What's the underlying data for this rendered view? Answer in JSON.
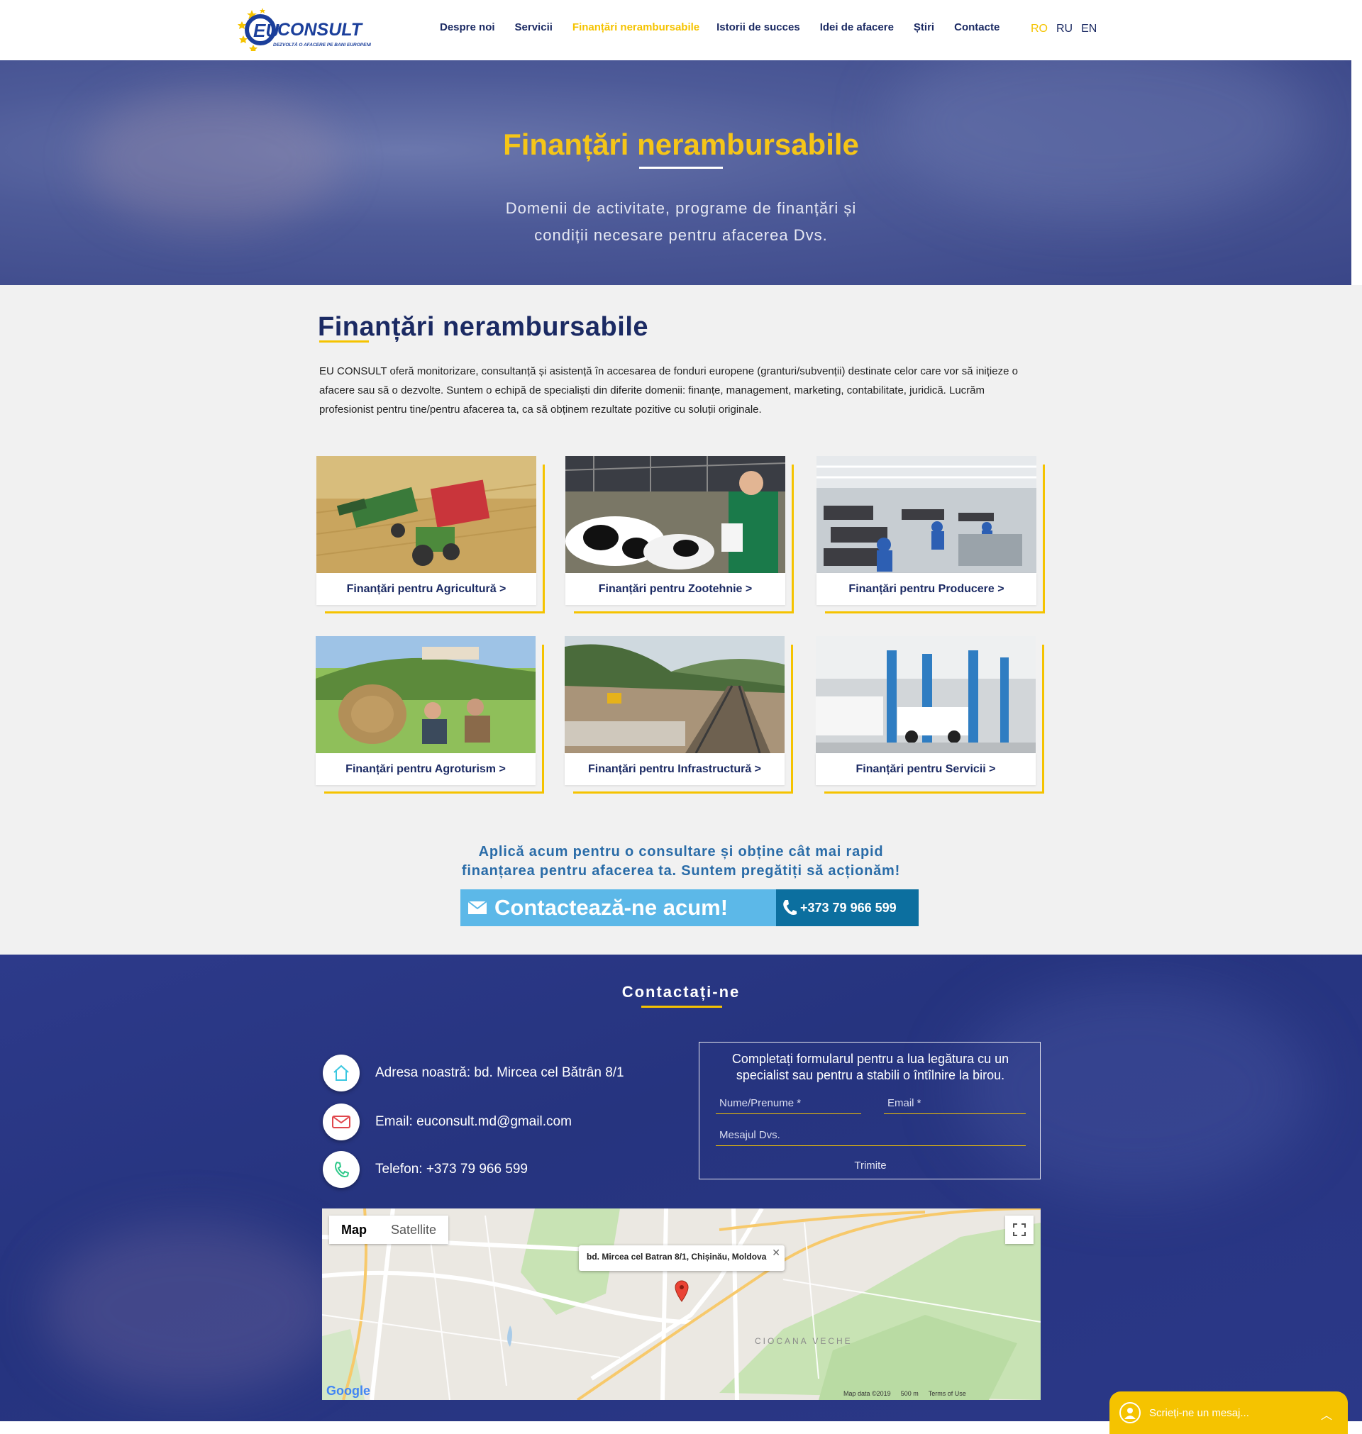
{
  "header": {
    "logo": {
      "brand": "EU CONSULT",
      "tagline": "DEZVOLTĂ O AFACERE PE BANI EUROPENI"
    },
    "nav": [
      {
        "label": "Despre noi",
        "active": false
      },
      {
        "label": "Servicii",
        "active": false
      },
      {
        "label": "Finanțări nerambursabile",
        "active": true
      },
      {
        "label": "Istorii de succes",
        "active": false
      },
      {
        "label": "Idei de afacere",
        "active": false
      },
      {
        "label": "Știri",
        "active": false
      },
      {
        "label": "Contacte",
        "active": false
      }
    ],
    "languages": [
      "RO",
      "RU",
      "EN"
    ]
  },
  "hero": {
    "title": "Finanțări nerambursabile",
    "subtitle_line1": "Domenii de activitate, programe de finanțări și",
    "subtitle_line2": "condiții necesare pentru afacerea Dvs."
  },
  "main": {
    "title": "Finanțări nerambursabile",
    "intro": "EU CONSULT oferă monitorizare, consultanță și asistență în accesarea de fonduri europene (granturi/subvenții) destinate celor care vor să inițieze o afacere sau să o dezvolte. Suntem o echipă de specialiști din diferite domenii: finanțe, management, marketing, contabilitate, juridică. Lucrăm profesionist pentru tine/pentru afacerea ta, ca să obținem rezultate pozitive cu soluții originale.",
    "cards": [
      {
        "label": "Finanțări pentru Agricultură >"
      },
      {
        "label": "Finanțări pentru Zootehnie >"
      },
      {
        "label": "Finanțări pentru Producere >"
      },
      {
        "label": "Finanțări pentru Agroturism >"
      },
      {
        "label": "Finanțări pentru Infrastructură >"
      },
      {
        "label": "Finanțări pentru Servicii >"
      }
    ],
    "cta_line1": "Aplică acum pentru o consultare și obține cât mai rapid",
    "cta_line2": "finanțarea pentru afacerea ta. Suntem pregătiți să acționăm!",
    "cta_button": "Contactează-ne acum!",
    "cta_phone": "+373 79 966 599"
  },
  "contact": {
    "title": "Contactați-ne",
    "address": "Adresa noastră: bd. Mircea cel Bătrân 8/1",
    "email": "Email: euconsult.md@gmail.com",
    "phone": "Telefon: +373 79 966 599",
    "form": {
      "heading_line1": "Completați formularul pentru a lua legătura cu un",
      "heading_line2": "specialist sau pentru a stabili o întîlnire la birou.",
      "name_placeholder": "Nume/Prenume *",
      "email_placeholder": "Email *",
      "message_placeholder": "Mesajul Dvs.",
      "submit": "Trimite"
    },
    "map": {
      "tab_map": "Map",
      "tab_satellite": "Satellite",
      "info": "bd. Mircea cel Batran 8/1, Chișinău, Moldova",
      "district": "CIOCANA VECHE",
      "google": "Google",
      "map_data": "Map data ©2019",
      "scale": "500 m",
      "terms": "Terms of Use"
    }
  },
  "chat": {
    "placeholder": "Scrieți-ne un mesaj..."
  },
  "colors": {
    "accent": "#f5c300",
    "navy": "#1b2a63",
    "cta_light": "#5cb8e8",
    "cta_dark": "#0c6f9f"
  }
}
